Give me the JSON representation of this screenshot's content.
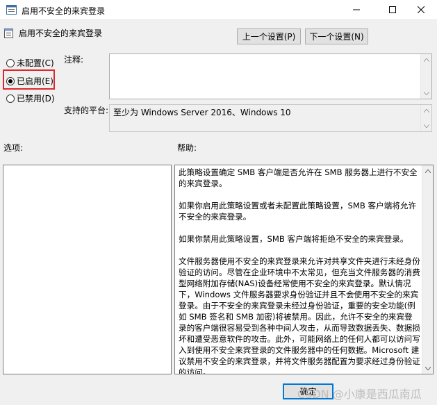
{
  "window": {
    "title": "启用不安全的来宾登录"
  },
  "header": {
    "policy_name": "启用不安全的来宾登录",
    "prev_button": "上一个设置(P)",
    "next_button": "下一个设置(N)"
  },
  "state_options": {
    "not_configured": "未配置(C)",
    "enabled": "已启用(E)",
    "disabled": "已禁用(D)",
    "selected": "enabled"
  },
  "fields": {
    "comment_label": "注释:",
    "comment_value": "",
    "platform_label": "支持的平台:",
    "platform_value": "至少为 Windows Server 2016、Windows 10"
  },
  "sections": {
    "options_label": "选项:",
    "help_label": "帮助:"
  },
  "help": {
    "paragraphs": [
      "此策略设置确定 SMB 客户端是否允许在 SMB 服务器上进行不安全的来宾登录。",
      "如果你启用此策略设置或者未配置此策略设置，SMB 客户端将允许不安全的来宾登录。",
      "如果你禁用此策略设置，SMB 客户端将拒绝不安全的来宾登录。",
      "文件服务器使用不安全的来宾登录来允许对共享文件夹进行未经身份验证的访问。尽管在企业环境中不太常见，但充当文件服务器的消费型网络附加存储(NAS)设备经常使用不安全的来宾登录。默认情况下，Windows 文件服务器要求身份验证并且不会使用不安全的来宾登录。由于不安全的来宾登录未经过身份验证，重要的安全功能(例如 SMB 签名和 SMB 加密)将被禁用。因此，允许不安全的来宾登录的客户端很容易受到各种中间人攻击，从而导致数据丢失、数据损坏和遭受恶意软件的攻击。此外，可能网络上的任何人都可以访问写入到使用不安全来宾登录的文件服务器中的任何数据。Microsoft 建议禁用不安全的来宾登录，并将文件服务器配置为要求经过身份验证的访问。"
    ]
  },
  "footer": {
    "ok_button": "确定",
    "watermark": "CSDN @小康是西瓜南瓜"
  }
}
